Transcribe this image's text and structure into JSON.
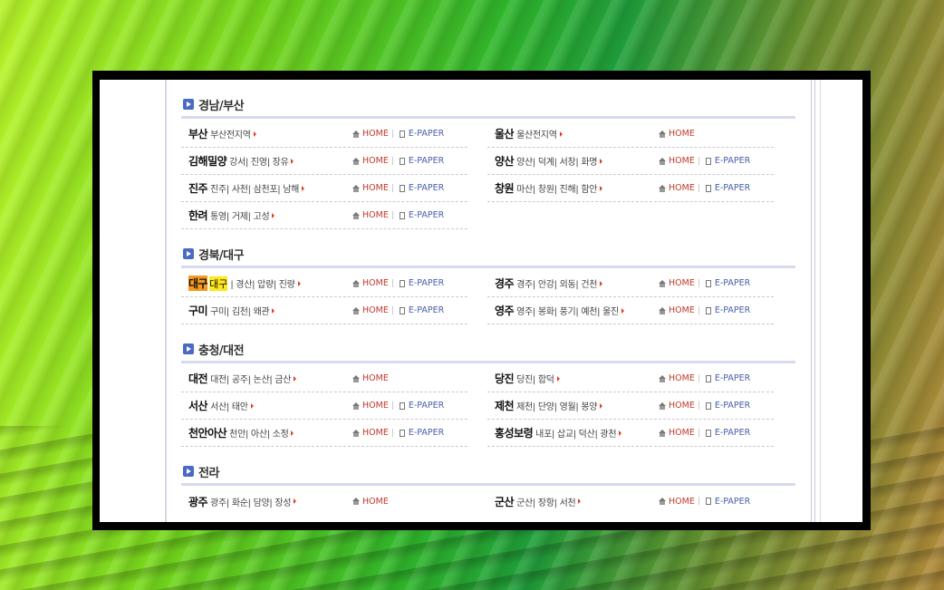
{
  "home_label": "HOME",
  "epaper_label": "E-PAPER",
  "sections": [
    {
      "title": "경남/부산",
      "items": [
        {
          "city": "부산",
          "sub": "부산전지역",
          "epaper": true
        },
        {
          "city": "울산",
          "sub": "울산전지역",
          "epaper": false
        },
        {
          "city": "김해밀양",
          "sub": "강서| 진영| 장유",
          "epaper": true
        },
        {
          "city": "양산",
          "sub": "양산| 덕계| 서창| 화명",
          "epaper": true
        },
        {
          "city": "진주",
          "sub": "진주| 사천| 삼천포| 남해",
          "epaper": true
        },
        {
          "city": "창원",
          "sub": "마산| 창원| 진해| 함안",
          "epaper": true
        },
        {
          "city": "한려",
          "sub": "통영| 거제| 고성",
          "epaper": true
        }
      ]
    },
    {
      "title": "경북/대구",
      "items": [
        {
          "city": "대구",
          "city2": "대구",
          "sub": "| 경산| 압량| 진량",
          "epaper": true,
          "highlight": true
        },
        {
          "city": "경주",
          "sub": "경주| 안강| 외동| 건천",
          "epaper": true
        },
        {
          "city": "구미",
          "sub": "구미| 김천| 왜관",
          "epaper": true
        },
        {
          "city": "영주",
          "sub": "영주| 봉화| 풍기| 예천| 울진",
          "epaper": true
        }
      ]
    },
    {
      "title": "충청/대전",
      "items": [
        {
          "city": "대전",
          "sub": "대전| 공주| 논산| 금산",
          "epaper": false
        },
        {
          "city": "당진",
          "sub": "당진| 합덕",
          "epaper": true
        },
        {
          "city": "서산",
          "sub": "서산| 태안",
          "epaper": true
        },
        {
          "city": "제천",
          "sub": "제천| 단양| 영월| 봉양",
          "epaper": true
        },
        {
          "city": "천안아산",
          "sub": "천안| 아산| 소정",
          "epaper": true
        },
        {
          "city": "홍성보령",
          "sub": "내포| 삽교| 덕산| 광천",
          "epaper": true
        }
      ]
    },
    {
      "title": "전라",
      "items": [
        {
          "city": "광주",
          "sub": "광주| 화순| 담양| 장성",
          "epaper": false
        },
        {
          "city": "군산",
          "sub": "군산| 장항| 서천",
          "epaper": true
        }
      ]
    }
  ]
}
